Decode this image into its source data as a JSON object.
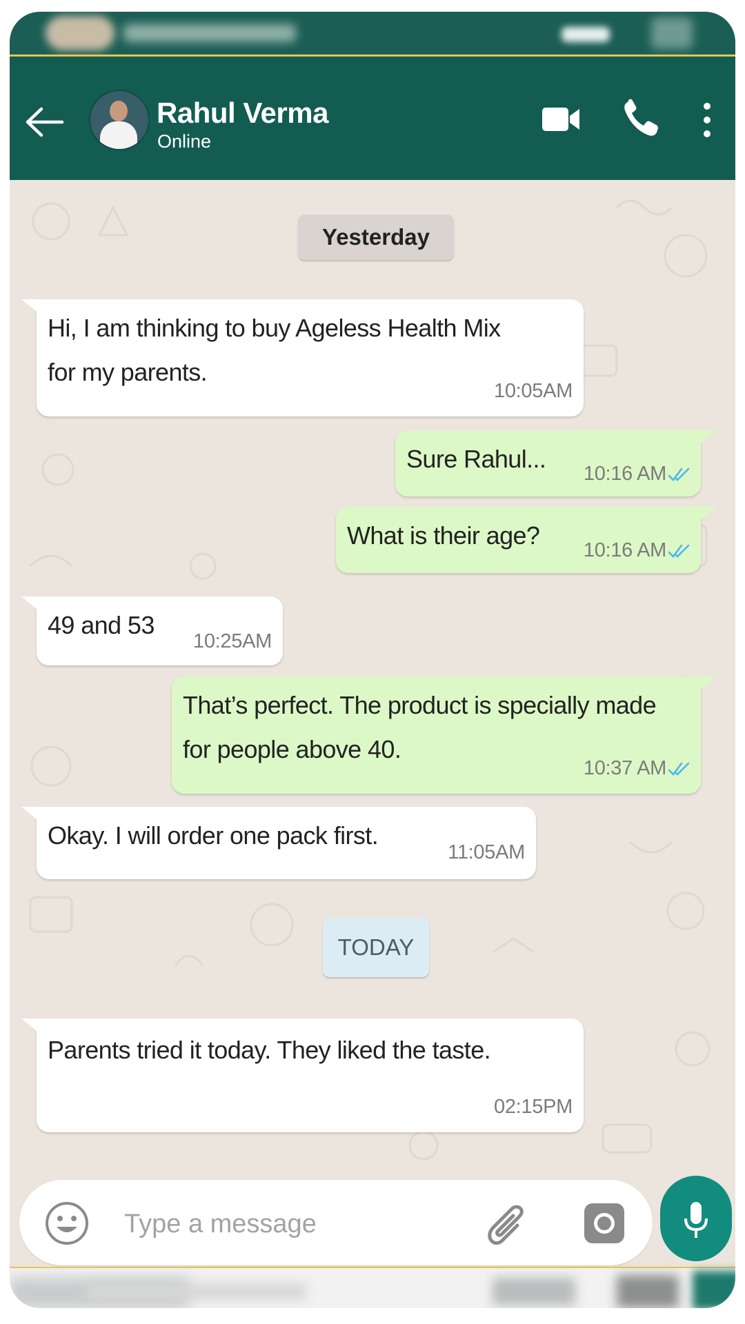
{
  "contact": {
    "name": "Rahul Verma",
    "status": "Online"
  },
  "header_icons": {
    "back": "back-arrow-icon",
    "video": "video-call-icon",
    "call": "phone-icon",
    "menu": "more-vert-icon"
  },
  "date_chips": {
    "yesterday": "Yesterday",
    "today": "TODAY"
  },
  "messages": [
    {
      "direction": "incoming",
      "lines": [
        "Hi, I am thinking to buy Ageless Health Mix",
        "for my parents."
      ],
      "time": "10:05AM"
    },
    {
      "direction": "outgoing",
      "lines": [
        "Sure Rahul..."
      ],
      "time": "10:16 AM",
      "read": true
    },
    {
      "direction": "outgoing",
      "lines": [
        "What is their age?"
      ],
      "time": "10:16 AM",
      "read": true
    },
    {
      "direction": "incoming",
      "lines": [
        "49 and 53"
      ],
      "time": "10:25AM"
    },
    {
      "direction": "outgoing",
      "lines": [
        "That’s perfect. The product is specially made",
        "for people above 40."
      ],
      "time": "10:37 AM",
      "read": true
    },
    {
      "direction": "incoming",
      "lines": [
        "Okay. I will order one pack first."
      ],
      "time": "11:05AM"
    },
    {
      "direction": "incoming",
      "lines": [
        "Parents tried it today. They liked the taste."
      ],
      "time": "02:15PM"
    }
  ],
  "composer": {
    "placeholder": "Type a message",
    "value": "",
    "icons": [
      "emoji-icon",
      "attach-icon",
      "camera-icon",
      "mic-icon"
    ]
  },
  "colors": {
    "header": "#135c52",
    "chat_bg": "#ece5dd",
    "outgoing_bubble": "#dcf8c6",
    "incoming_bubble": "#ffffff",
    "read_ticks": "#4fb6ec",
    "mic_button": "#128c7e"
  }
}
